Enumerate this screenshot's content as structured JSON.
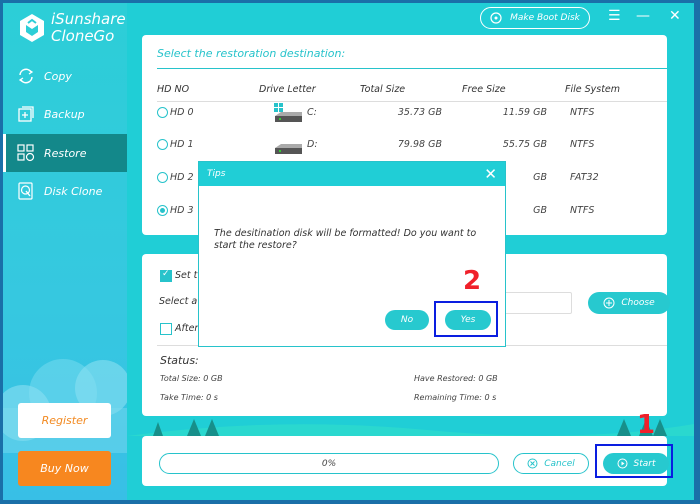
{
  "app": {
    "name_line1": "iSunshare",
    "name_line2": "CloneGo"
  },
  "sidebar": {
    "items": [
      {
        "label": "Copy",
        "icon": "refresh-icon"
      },
      {
        "label": "Backup",
        "icon": "backup-icon"
      },
      {
        "label": "Restore",
        "icon": "restore-icon",
        "active": true
      },
      {
        "label": "Disk Clone",
        "icon": "disk-clone-icon"
      }
    ],
    "register_label": "Register",
    "buy_label": "Buy Now"
  },
  "topbar": {
    "boot_label": "Make Boot Disk",
    "menu_glyph": "☰",
    "minimize_glyph": "—",
    "close_glyph": "✕"
  },
  "destination": {
    "title": "Select the restoration destination:",
    "headers": [
      "HD NO",
      "Drive Letter",
      "Total Size",
      "Free Size",
      "File System"
    ],
    "rows": [
      {
        "hd": "HD 0",
        "letter": "C:",
        "total": "35.73 GB",
        "free": "11.59 GB",
        "fs": "NTFS",
        "selected": false,
        "system": true
      },
      {
        "hd": "HD 1",
        "letter": "D:",
        "total": "79.98 GB",
        "free": "55.75 GB",
        "fs": "NTFS",
        "selected": false,
        "system": false
      },
      {
        "hd": "HD 2",
        "letter": "",
        "total": "",
        "free": "GB",
        "fs": "FAT32",
        "selected": false,
        "system": false
      },
      {
        "hd": "HD 3",
        "letter": "",
        "total": "",
        "free": "GB",
        "fs": "NTFS",
        "selected": true,
        "system": false
      }
    ]
  },
  "options": {
    "set_label": "Set t",
    "select_label": "Select a",
    "after_label": "After",
    "choose_label": "Choose",
    "path_value": ""
  },
  "status": {
    "title": "Status:",
    "total_size": "Total Size: 0 GB",
    "take_time": "Take Time: 0 s",
    "have_restored": "Have Restored: 0 GB",
    "remaining_time": "Remaining Time: 0 s"
  },
  "footer": {
    "progress_text": "0%",
    "progress_value": 0,
    "cancel_label": "Cancel",
    "start_label": "Start"
  },
  "dialog": {
    "title": "Tips",
    "message": "The desitination disk will be formatted! Do you want to start the restore?",
    "no_label": "No",
    "yes_label": "Yes"
  },
  "annotations": {
    "step1": "1",
    "step2": "2"
  },
  "colors": {
    "accent": "#20ced6",
    "active_nav": "#13888a",
    "buy": "#f7871f",
    "highlight_box": "#0a1ee0",
    "step_number": "#f0202a"
  }
}
